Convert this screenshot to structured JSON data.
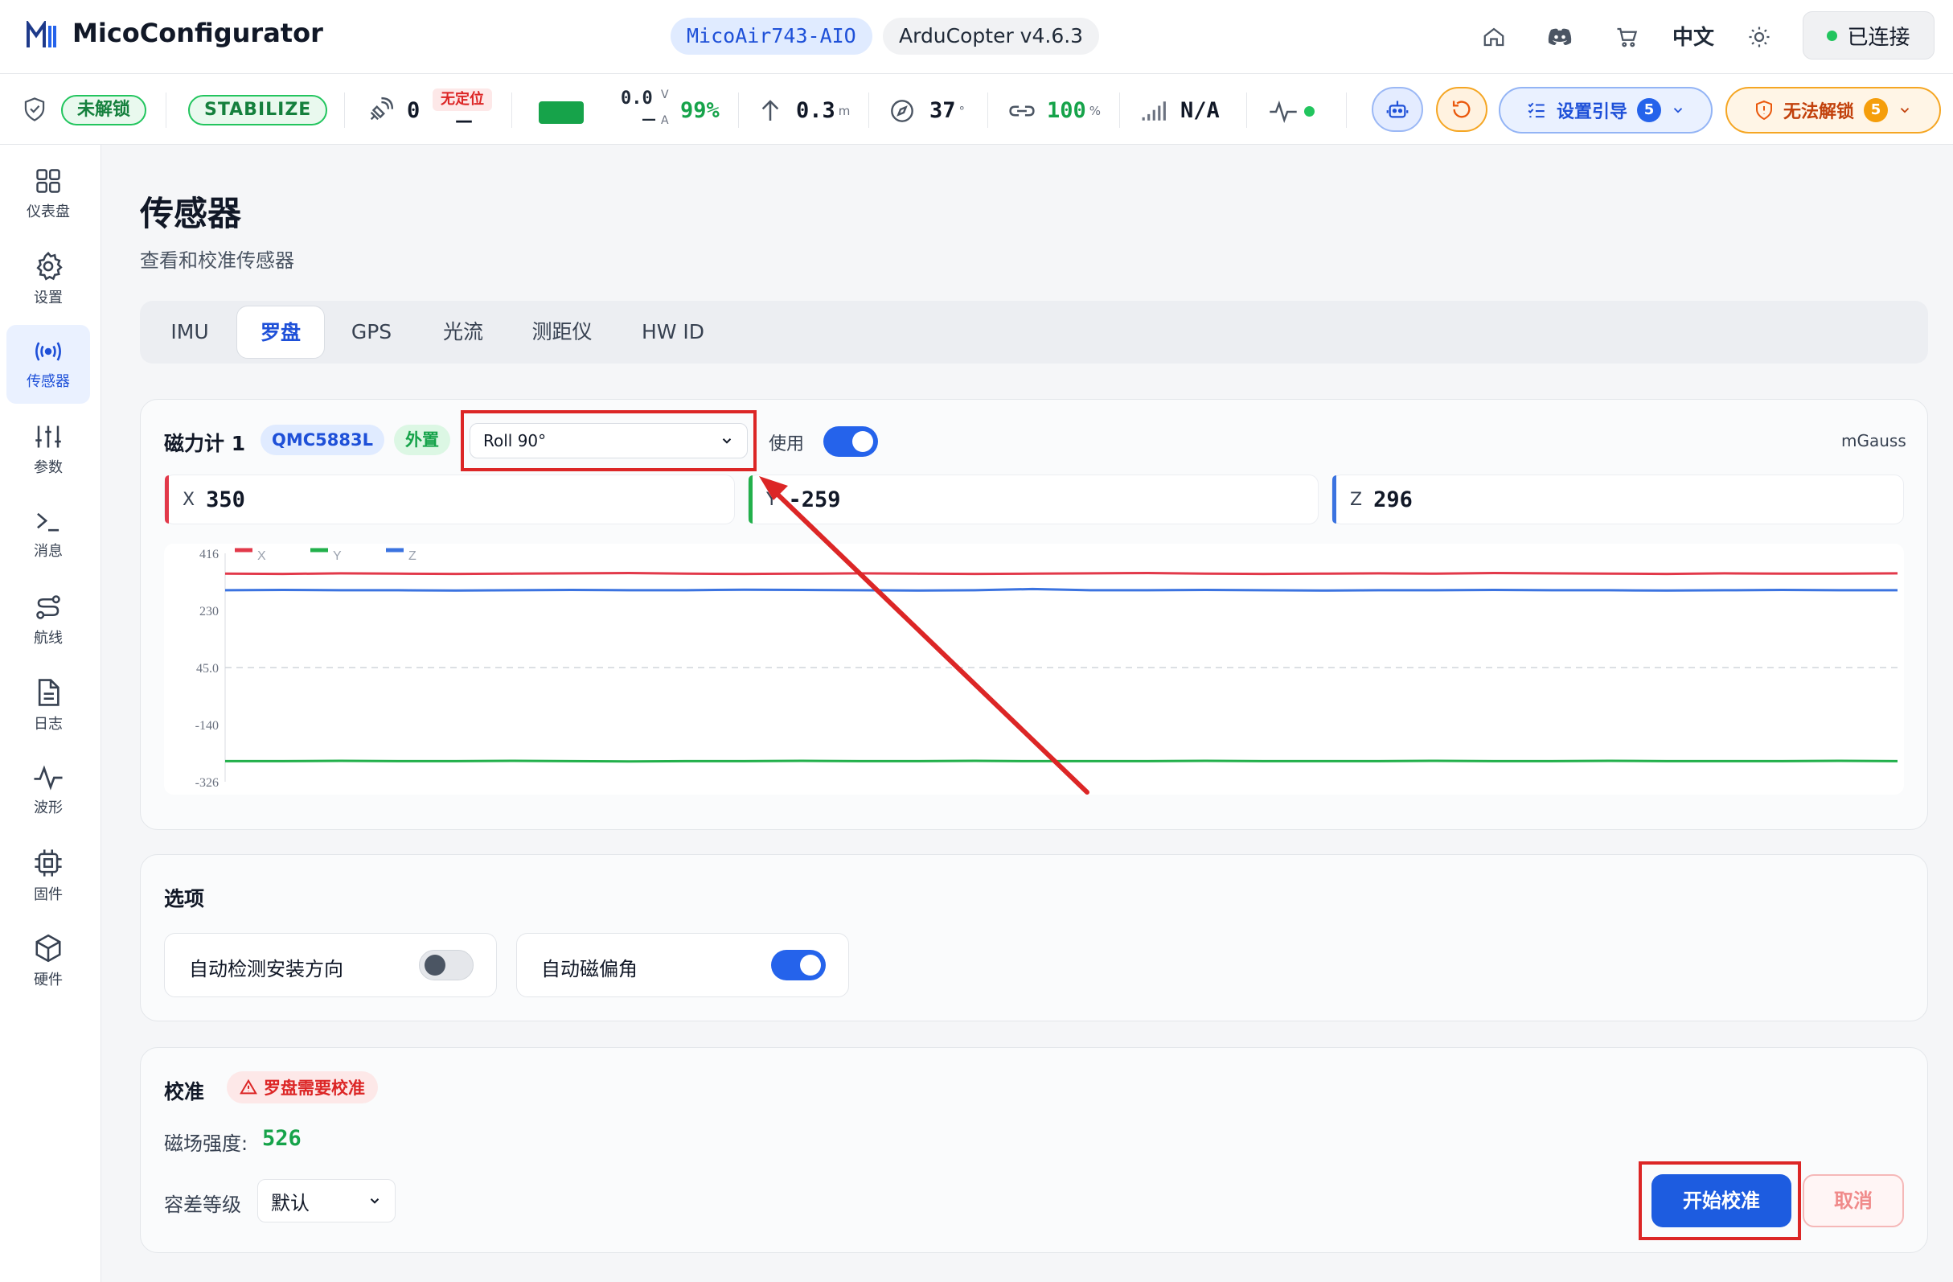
{
  "header": {
    "app_title": "MicoConfigurator",
    "board": "MicoAir743-AIO",
    "firmware": "ArduCopter v4.6.3",
    "language": "中文",
    "connection_label": "已连接"
  },
  "status": {
    "arm_state": "未解锁",
    "flight_mode": "STABILIZE",
    "satellites": "0",
    "gps_fix": "无定位",
    "gps_fix_sub": "—",
    "voltage": "0.0",
    "voltage_unit": "V",
    "current": "—",
    "current_unit": "A",
    "battery_percent": "99%",
    "altitude": "0.3",
    "altitude_unit": "m",
    "heading": "37",
    "heading_unit": "°",
    "link_quality": "100",
    "link_unit": "%",
    "rssi": "N/A",
    "setup_guide_label": "设置引导",
    "setup_guide_count": "5",
    "arm_check_label": "无法解锁",
    "arm_check_count": "5",
    "colors": {
      "ok": "#22c55e",
      "warn": "#f59e0b",
      "error": "#dc2626",
      "accent": "#2563eb"
    }
  },
  "sidebar": {
    "items": [
      {
        "label": "仪表盘",
        "icon": "grid-icon"
      },
      {
        "label": "设置",
        "icon": "gear-icon"
      },
      {
        "label": "传感器",
        "icon": "broadcast-icon",
        "active": true
      },
      {
        "label": "参数",
        "icon": "sliders-icon"
      },
      {
        "label": "消息",
        "icon": "terminal-icon"
      },
      {
        "label": "航线",
        "icon": "route-icon"
      },
      {
        "label": "日志",
        "icon": "file-icon"
      },
      {
        "label": "波形",
        "icon": "waveform-icon"
      },
      {
        "label": "固件",
        "icon": "chip-icon"
      },
      {
        "label": "硬件",
        "icon": "cube-icon"
      }
    ]
  },
  "page": {
    "title": "传感器",
    "subtitle": "查看和校准传感器",
    "tabs": [
      "IMU",
      "罗盘",
      "GPS",
      "光流",
      "测距仪",
      "HW ID"
    ],
    "active_tab": "罗盘"
  },
  "magnetometer": {
    "title": "磁力计 1",
    "chip_model": "QMC5883L",
    "chip_location": "外置",
    "orientation": "Roll 90°",
    "use_label": "使用",
    "use_enabled": true,
    "units": "mGauss",
    "axes": [
      {
        "axis": "X",
        "value": "350"
      },
      {
        "axis": "Y",
        "value": "-259"
      },
      {
        "axis": "Z",
        "value": "296"
      }
    ]
  },
  "chart_data": {
    "type": "line",
    "y_ticks": [
      "416",
      "230",
      "45.0",
      "-140",
      "-326"
    ],
    "ylim": [
      -326,
      416
    ],
    "grid": false,
    "legend_position": "top-left",
    "series": [
      {
        "name": "X",
        "color": "#e2394a",
        "values": [
          350,
          349,
          351,
          350,
          349,
          350,
          351,
          352,
          350,
          349,
          350,
          351,
          350,
          349,
          350,
          351,
          352,
          350,
          349,
          350,
          351,
          350,
          352,
          351,
          350,
          349,
          351,
          350,
          350,
          351
        ]
      },
      {
        "name": "Y",
        "color": "#22b04b",
        "values": [
          -259,
          -259,
          -258,
          -259,
          -259,
          -258,
          -259,
          -260,
          -259,
          -259,
          -258,
          -259,
          -259,
          -258,
          -259,
          -259,
          -259,
          -258,
          -259,
          -259,
          -259,
          -258,
          -259,
          -259,
          -258,
          -259,
          -259,
          -259,
          -258,
          -259
        ]
      },
      {
        "name": "Z",
        "color": "#3b73e0",
        "values": [
          296,
          297,
          296,
          296,
          295,
          296,
          297,
          296,
          296,
          298,
          297,
          296,
          295,
          296,
          300,
          296,
          296,
          297,
          296,
          295,
          296,
          296,
          297,
          296,
          296,
          295,
          296,
          297,
          296,
          296
        ]
      }
    ]
  },
  "options": {
    "title": "选项",
    "auto_orientation": {
      "label": "自动检测安装方向",
      "enabled": false
    },
    "auto_declination": {
      "label": "自动磁偏角",
      "enabled": true
    }
  },
  "calibration": {
    "title": "校准",
    "warning": "罗盘需要校准",
    "field_strength_label": "磁场强度:",
    "field_strength_value": "526",
    "tolerance_label": "容差等级",
    "tolerance_value": "默认",
    "start_label": "开始校准",
    "cancel_label": "取消"
  }
}
